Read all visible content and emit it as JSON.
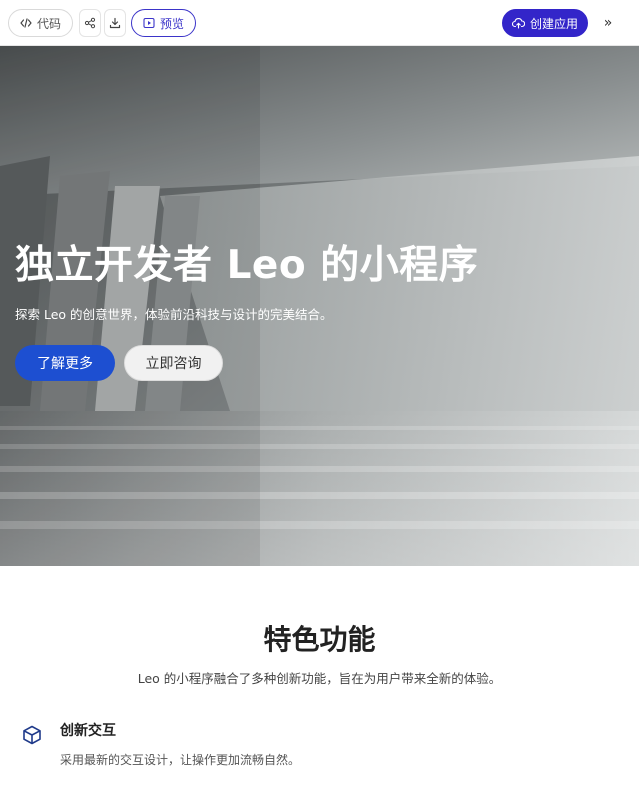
{
  "toolbar": {
    "code_label": "代码",
    "preview_label": "预览",
    "create_label": "创建应用",
    "expand_label": "»",
    "icons": {
      "code": "code-icon",
      "share": "share-icon",
      "download": "download-icon",
      "preview": "play-icon",
      "create": "cloud-upload-icon"
    },
    "colors": {
      "accent": "#3325c9"
    }
  },
  "hero": {
    "title": "独立开发者 Leo 的小程序",
    "subtitle": "探索 Leo 的创意世界，体验前沿科技与设计的完美结合。",
    "primary_button": "了解更多",
    "secondary_button": "立即咨询",
    "colors": {
      "primary_button": "#1d4fd1"
    }
  },
  "features": {
    "title": "特色功能",
    "subtitle": "Leo 的小程序融合了多种创新功能，旨在为用户带来全新的体验。",
    "items": [
      {
        "icon": "cube-icon",
        "title": "创新交互",
        "description": "采用最新的交互设计，让操作更加流畅自然。"
      }
    ]
  }
}
